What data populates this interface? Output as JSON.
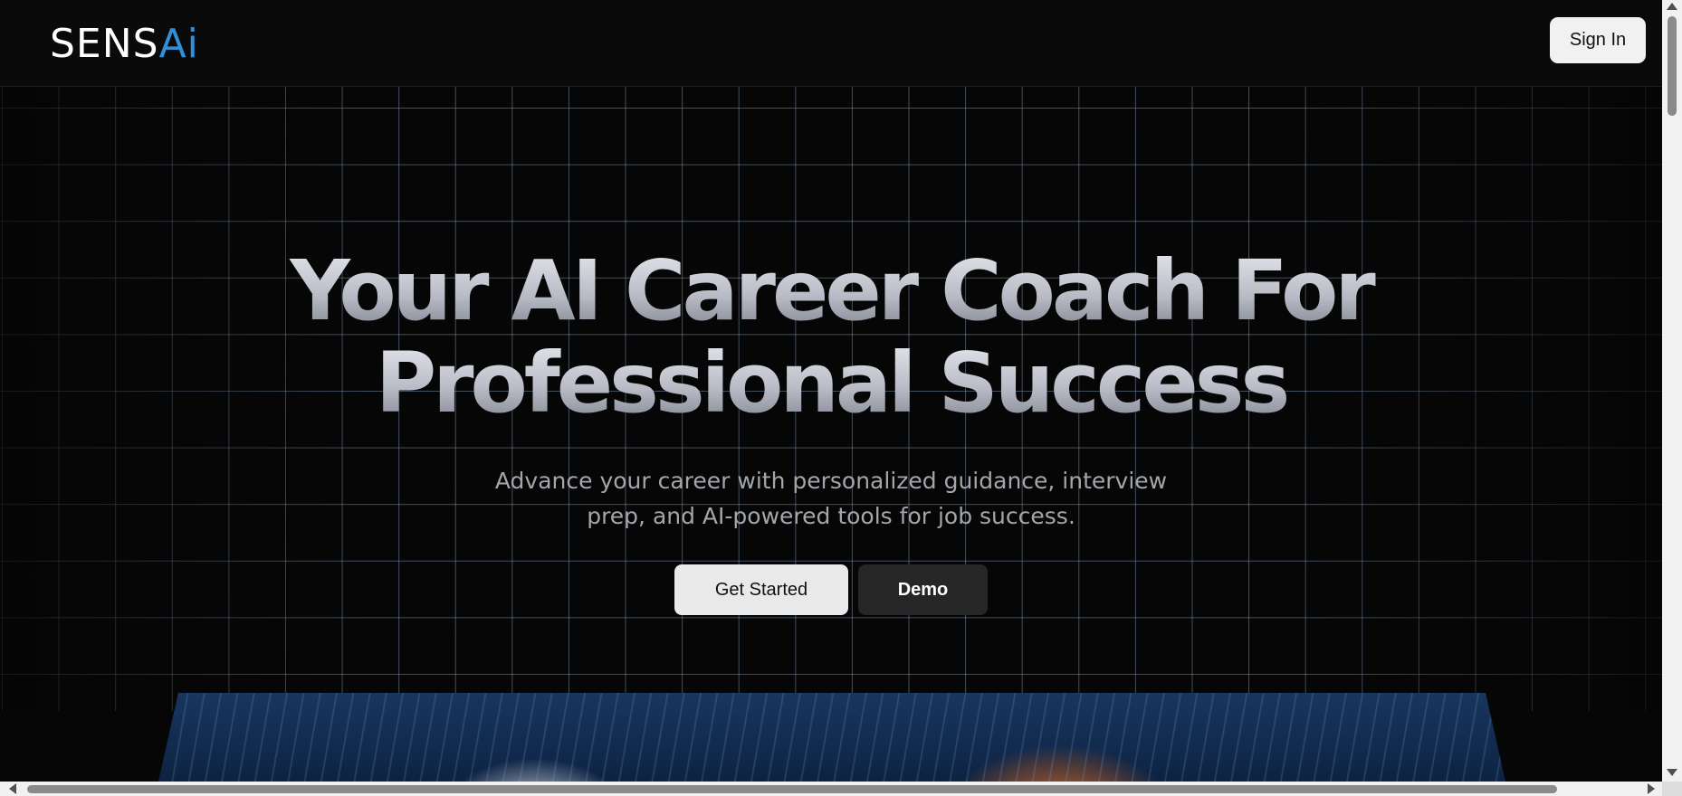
{
  "header": {
    "logo_main": "SENS",
    "logo_accent": "Ai",
    "signin_label": "Sign In"
  },
  "hero": {
    "title_line1": "Your AI Career Coach For",
    "title_line2": "Professional Success",
    "subtitle_line1": "Advance your career with personalized guidance, interview",
    "subtitle_line2": "prep, and AI-powered tools for job success.",
    "primary_cta": "Get Started",
    "secondary_cta": "Demo"
  },
  "colors": {
    "background": "#060606",
    "logo_accent": "#2f8fd8",
    "grid_line": "#8caac8",
    "primary_button": "#e9e9e9",
    "secondary_button": "#262626"
  }
}
